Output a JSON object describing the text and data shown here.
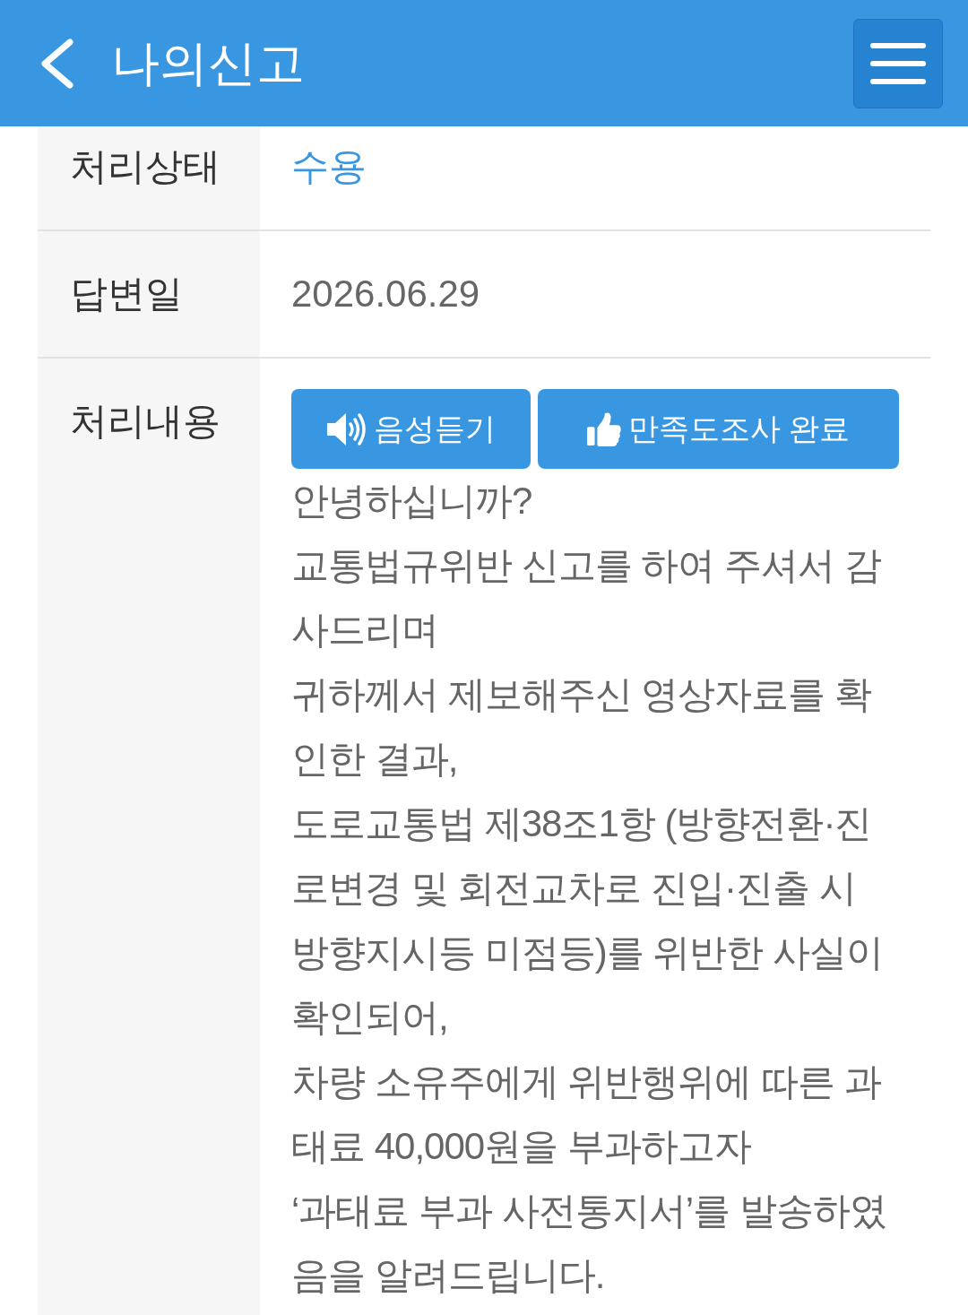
{
  "header": {
    "title": "나의신고"
  },
  "rows": [
    {
      "kind": "status",
      "label": "처리상태",
      "value": "수용"
    },
    {
      "kind": "text",
      "label": "답변일",
      "value": "2026.06.29"
    },
    {
      "kind": "content",
      "label": "처리내용",
      "buttons": [
        {
          "kind": "listen",
          "label": "음성듣기"
        },
        {
          "kind": "survey",
          "label": "만족도조사 완료"
        }
      ],
      "paragraphs": [
        "안녕하십니까?",
        "교통법규위반 신고를 하여 주셔서 감사드리며",
        "귀하께서 제보해주신 영상자료를 확인한 결과,",
        "도로교통법 제38조1항 (방향전환·진로변경 및 회전교차로 진입·진출 시 방향지시등 미점등)를 위반한 사실이 확인되어,",
        "차량 소유주에게 위반행위에 따른 과태료 40,000원을 부과하고자",
        "‘과태료 부과 사전통지서’를 발송하였음을 알려드립니다."
      ]
    }
  ]
}
